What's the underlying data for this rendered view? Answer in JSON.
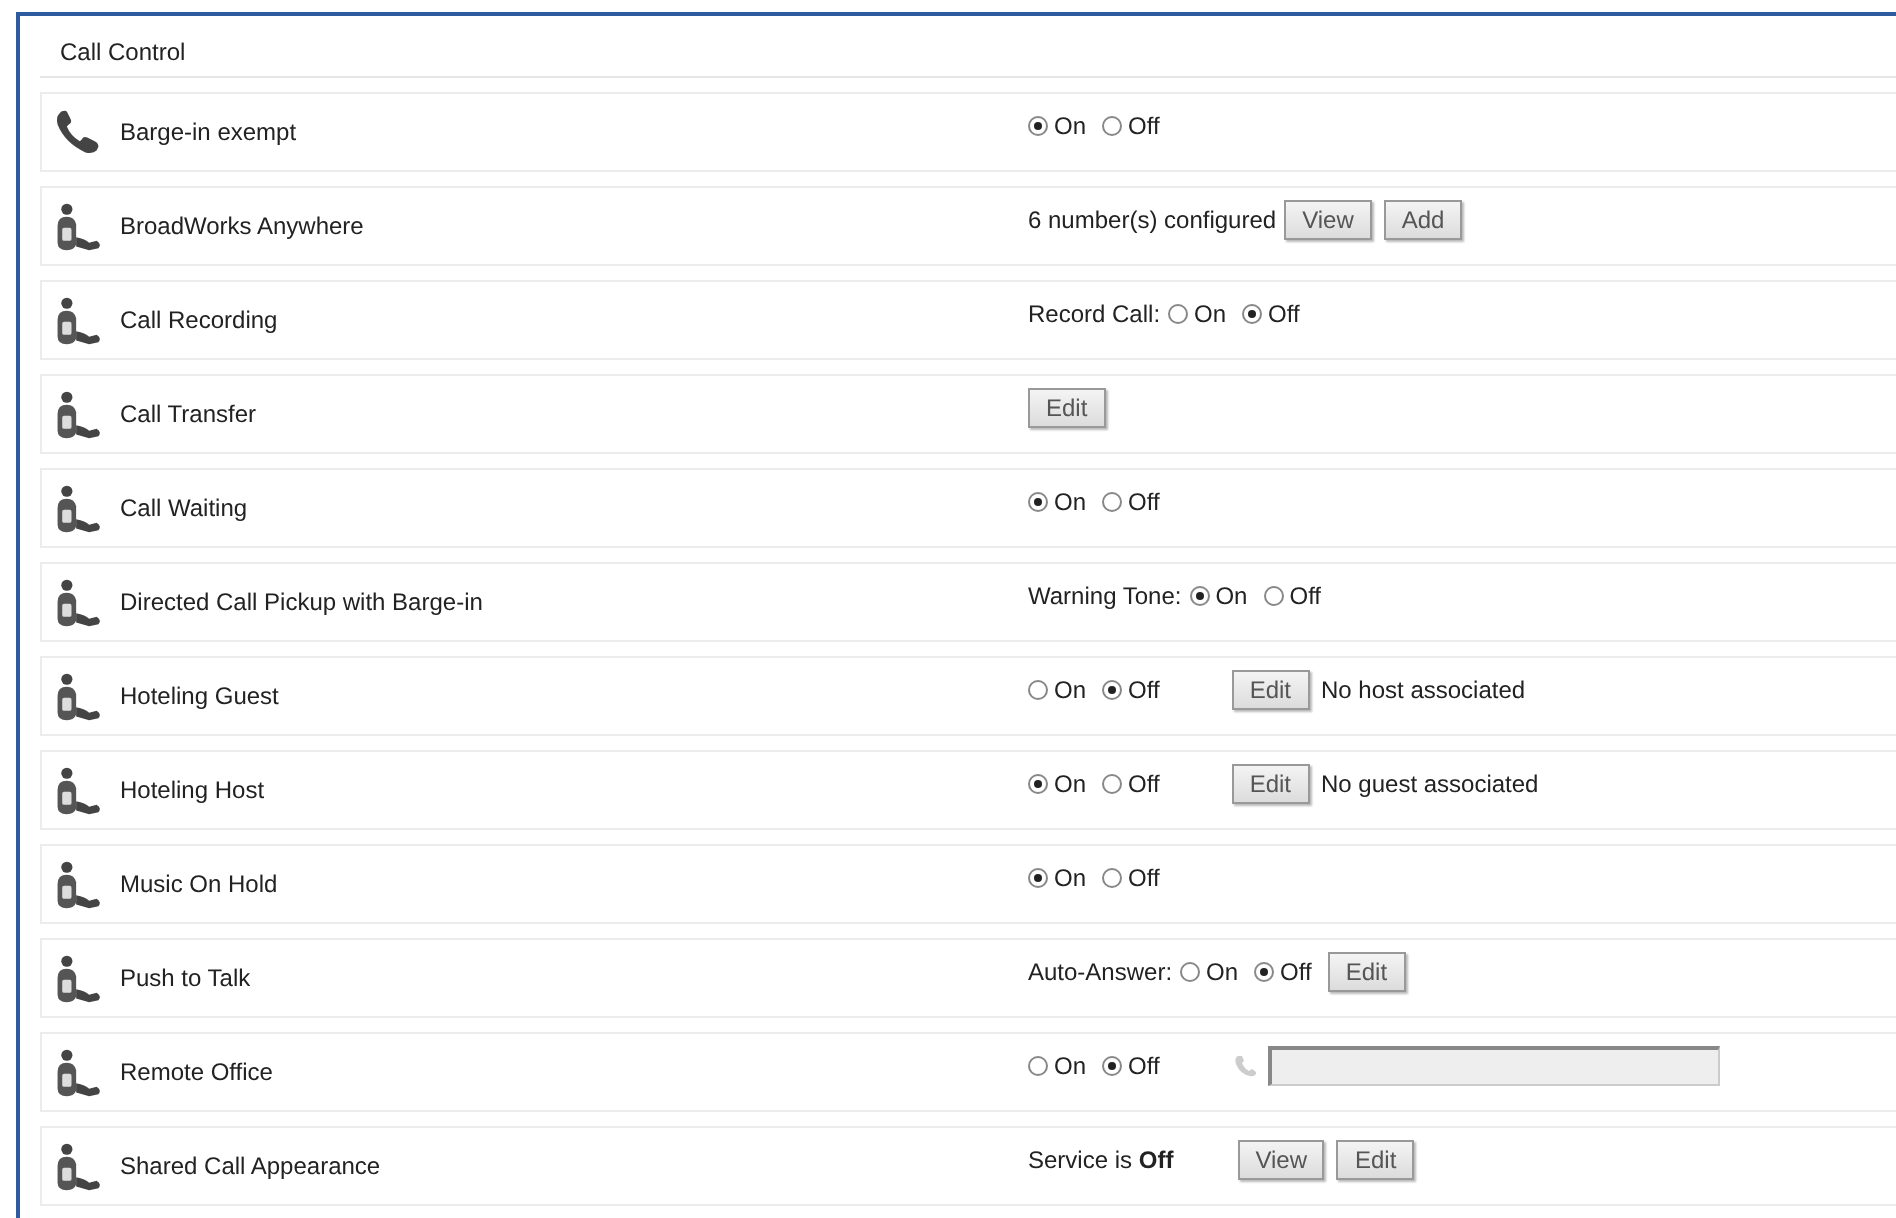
{
  "section": {
    "title": "Call Control"
  },
  "rows": [
    {
      "name": "Barge-in exempt",
      "kind": "phone",
      "controls": [
        {
          "kind": "radio",
          "label": "On",
          "selected": true
        },
        {
          "kind": "radio",
          "label": "Off",
          "selected": false
        }
      ]
    },
    {
      "name": "BroadWorks Anywhere",
      "kind": "person",
      "controls": [
        {
          "kind": "text",
          "text": "6 number(s) configured"
        },
        {
          "kind": "button",
          "label": "View"
        },
        {
          "kind": "button",
          "label": "Add"
        }
      ]
    },
    {
      "name": "Call Recording",
      "kind": "person",
      "controls": [
        {
          "kind": "text",
          "text": "Record Call:"
        },
        {
          "kind": "radio",
          "label": "On",
          "selected": false
        },
        {
          "kind": "radio",
          "label": "Off",
          "selected": true
        }
      ]
    },
    {
      "name": "Call Transfer",
      "kind": "person",
      "controls": [
        {
          "kind": "button",
          "label": "Edit"
        }
      ]
    },
    {
      "name": "Call Waiting",
      "kind": "person",
      "controls": [
        {
          "kind": "radio",
          "label": "On",
          "selected": true
        },
        {
          "kind": "radio",
          "label": "Off",
          "selected": false
        }
      ]
    },
    {
      "name": "Directed Call Pickup with Barge-in",
      "kind": "person",
      "controls": [
        {
          "kind": "text",
          "text": "Warning Tone:"
        },
        {
          "kind": "radio",
          "label": "On",
          "selected": true
        },
        {
          "kind": "radio",
          "label": "Off",
          "selected": false
        }
      ]
    },
    {
      "name": "Hoteling Guest",
      "kind": "person",
      "controls": [
        {
          "kind": "radio",
          "label": "On",
          "selected": false
        },
        {
          "kind": "radio",
          "label": "Off",
          "selected": true
        },
        {
          "kind": "spacer"
        },
        {
          "kind": "button",
          "label": "Edit"
        },
        {
          "kind": "text",
          "text": "No host associated"
        }
      ]
    },
    {
      "name": "Hoteling Host",
      "kind": "person",
      "controls": [
        {
          "kind": "radio",
          "label": "On",
          "selected": true
        },
        {
          "kind": "radio",
          "label": "Off",
          "selected": false
        },
        {
          "kind": "spacer"
        },
        {
          "kind": "button",
          "label": "Edit"
        },
        {
          "kind": "text",
          "text": "No guest associated"
        }
      ]
    },
    {
      "name": "Music On Hold",
      "kind": "person",
      "controls": [
        {
          "kind": "radio",
          "label": "On",
          "selected": true
        },
        {
          "kind": "radio",
          "label": "Off",
          "selected": false
        }
      ]
    },
    {
      "name": "Push to Talk",
      "kind": "person",
      "controls": [
        {
          "kind": "text",
          "text": "Auto-Answer:"
        },
        {
          "kind": "radio",
          "label": "On",
          "selected": false
        },
        {
          "kind": "radio",
          "label": "Off",
          "selected": true
        },
        {
          "kind": "button",
          "label": "Edit"
        }
      ]
    },
    {
      "name": "Remote Office",
      "kind": "person",
      "controls": [
        {
          "kind": "radio",
          "label": "On",
          "selected": false
        },
        {
          "kind": "radio",
          "label": "Off",
          "selected": true
        },
        {
          "kind": "spacer"
        },
        {
          "kind": "phone"
        },
        {
          "kind": "field",
          "disabled": true
        }
      ]
    },
    {
      "name": "Shared Call Appearance",
      "kind": "person",
      "controls": [
        {
          "kind": "text",
          "text": "Service is **Off**"
        },
        {
          "kind": "spacer"
        },
        {
          "kind": "button",
          "label": "View"
        },
        {
          "kind": "button",
          "label": "Edit"
        }
      ]
    }
  ]
}
